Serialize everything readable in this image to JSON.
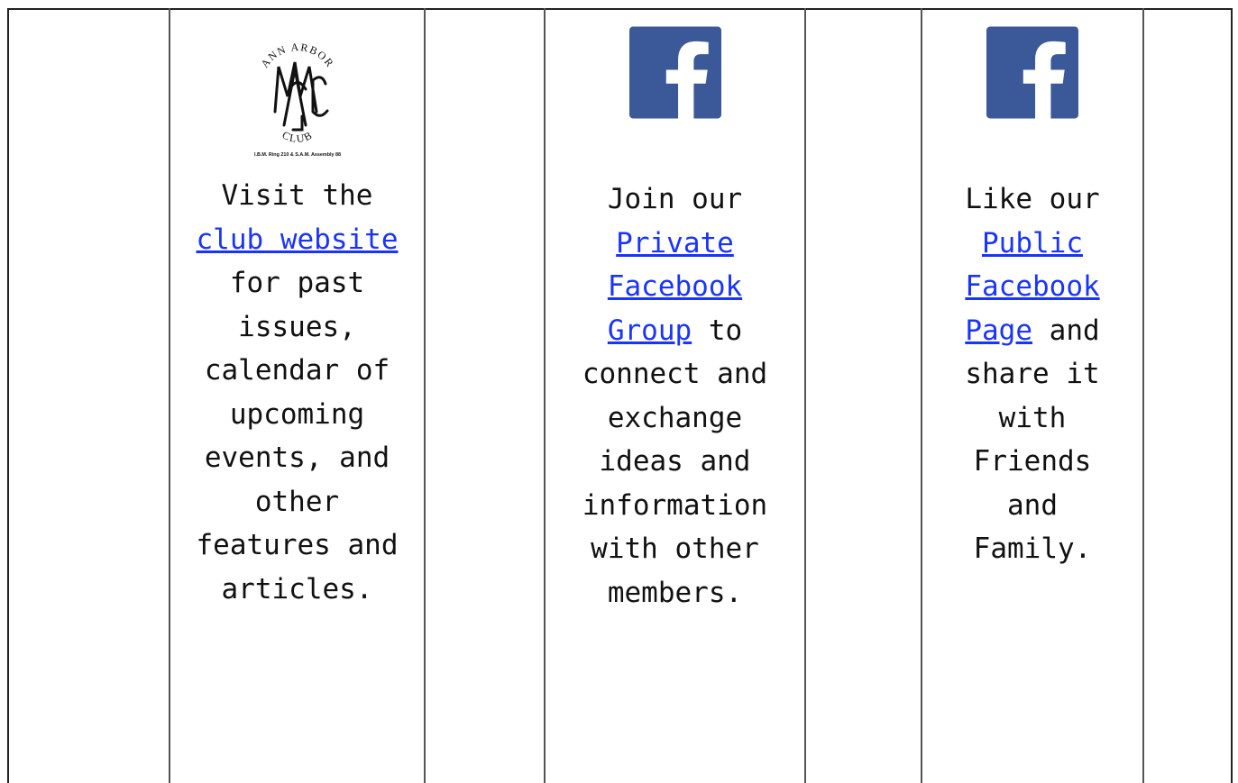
{
  "col1": {
    "logo": {
      "top_text": "ANN ARBOR",
      "monogram": "MAGIC",
      "bottom_text": "CLUB",
      "caption": "I.B.M. Ring 210 & S.A.M. Assembly 88"
    },
    "lead": "Visit the ",
    "link": "club website",
    "tail": " for past issues, calendar of upcoming events, and other features and articles."
  },
  "col2": {
    "icon": "facebook-icon",
    "lead": "Join our ",
    "link": "Private Facebook Group",
    "tail": " to connect and exchange ideas and information with other members."
  },
  "col3": {
    "icon": "facebook-icon",
    "lead": "Like our ",
    "link": "Public Facebook Page",
    "tail": " and share it with Friends and Family."
  },
  "colors": {
    "link": "#1a33ff",
    "facebook": "#3b5998",
    "border": "#222222"
  }
}
